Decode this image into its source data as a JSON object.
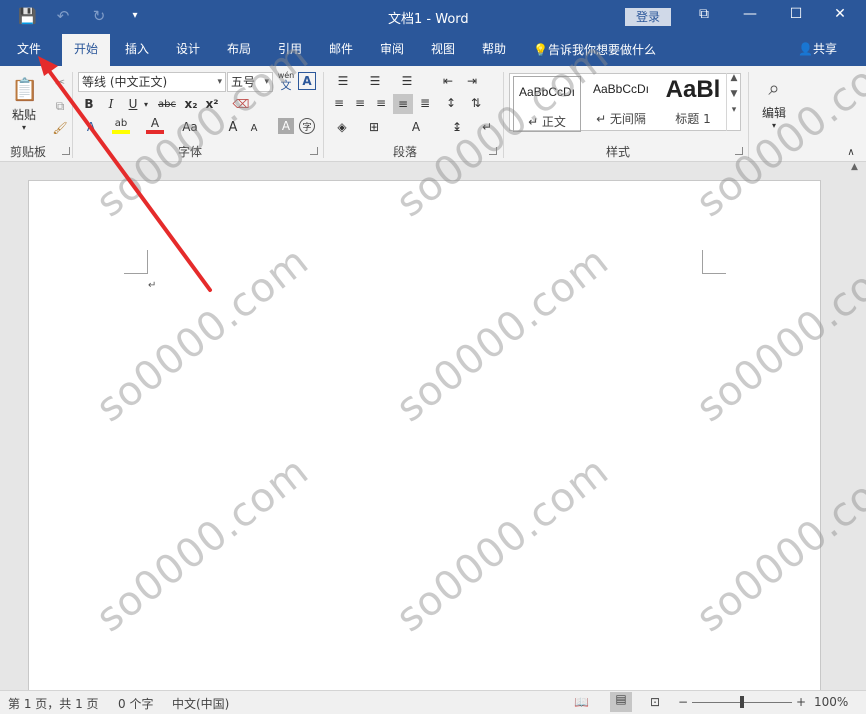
{
  "window": {
    "title": "文档1 - Word",
    "login_label": "登录",
    "controls": {
      "restore": "⧉",
      "minimize": "—",
      "maximize": "☐",
      "close": "✕"
    }
  },
  "qat": {
    "save": "💾",
    "undo": "↶",
    "redo": "↻",
    "customize": "▾"
  },
  "tabs": [
    {
      "label": "文件",
      "active": false
    },
    {
      "label": "开始",
      "active": true
    },
    {
      "label": "插入",
      "active": false
    },
    {
      "label": "设计",
      "active": false
    },
    {
      "label": "布局",
      "active": false
    },
    {
      "label": "引用",
      "active": false
    },
    {
      "label": "邮件",
      "active": false
    },
    {
      "label": "审阅",
      "active": false
    },
    {
      "label": "视图",
      "active": false
    },
    {
      "label": "帮助",
      "active": false
    }
  ],
  "tellme": "告诉我你想要做什么",
  "share": "共享",
  "ribbon": {
    "clipboard": {
      "label": "剪贴板",
      "paste": "粘贴"
    },
    "font": {
      "label": "字体",
      "font_name": "等线 (中文正文)",
      "font_size": "五号",
      "wen": "wén",
      "wen_char": "文",
      "bold": "B",
      "italic": "I",
      "underline": "U",
      "strike": "abc",
      "subscript": "x₂",
      "superscript": "x²",
      "font_color_letter": "A",
      "aa": "Aa",
      "grow": "A",
      "shrink": "A",
      "clear": "A",
      "char_border": "字"
    },
    "paragraph": {
      "label": "段落"
    },
    "styles": {
      "label": "样式",
      "items": [
        {
          "sample": "AaBbCcDı",
          "name": "↵ 正文"
        },
        {
          "sample": "AaBbCcDı",
          "name": "↵ 无间隔"
        },
        {
          "sample": "AaBl",
          "name": "标题 1"
        }
      ]
    },
    "editing": {
      "label": "编辑"
    }
  },
  "document": {
    "paragraph_mark": "↵"
  },
  "watermark": "so0000.com",
  "statusbar": {
    "page": "第 1 页，共 1 页",
    "words": "0 个字",
    "language": "中文(中国)",
    "zoom": "100%",
    "zoom_minus": "−",
    "zoom_plus": "+"
  },
  "colors": {
    "word_blue": "#2b579a",
    "arrow_red": "#e52b2b"
  }
}
